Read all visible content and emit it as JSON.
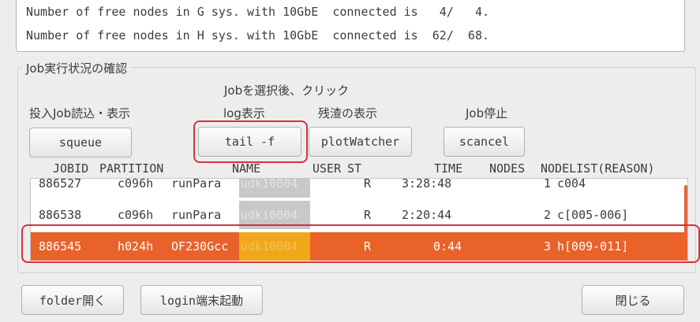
{
  "top_text": {
    "line1": "Number of free nodes in G sys. with 10GbE  connected is   4/   4.",
    "line2": "Number of free nodes in H sys. with 10GbE  connected is  62/  68."
  },
  "job_section": {
    "title": "Job実行状況の確認",
    "hint": "Jobを選択後、クリック",
    "label_submit": "投入Job読込・表示",
    "label_log": "log表示",
    "label_residual": "残渣の表示",
    "label_stop": "Job停止",
    "btn_squeue": "squeue",
    "btn_tail": "tail -f",
    "btn_plot": "plotWatcher",
    "btn_scancel": "scancel"
  },
  "job_list": {
    "headers": [
      "JOBID",
      "PARTITION",
      "NAME",
      "USER",
      "ST",
      "TIME",
      "NODES",
      "NODELIST(REASON)"
    ],
    "rows": [
      {
        "jobid": "886527",
        "partition": "c096h",
        "name": "runPara",
        "user": "udk10004",
        "st": "R",
        "time": "3:28:48",
        "nodes": "1",
        "nodelist": "c004"
      },
      {
        "jobid": "886538",
        "partition": "c096h",
        "name": "runPara",
        "user": "udki0004",
        "st": "R",
        "time": "2:20:44",
        "nodes": "2",
        "nodelist": "c[005-006]"
      },
      {
        "jobid": "886545",
        "partition": "h024h",
        "name": "OF230Gcc",
        "user": "udk10004",
        "st": "R",
        "time": "0:44",
        "nodes": "3",
        "nodelist": "h[009-011]"
      }
    ]
  },
  "bottom": {
    "btn_folder": "folder開く",
    "btn_login": "login端末起動",
    "btn_close": "閉じる"
  },
  "colors": {
    "selected_row": "#e8622a",
    "highlight_ring": "#d9303a",
    "user_mask": "#c8c8c8",
    "user_mask_selected": "#f0a81a"
  }
}
